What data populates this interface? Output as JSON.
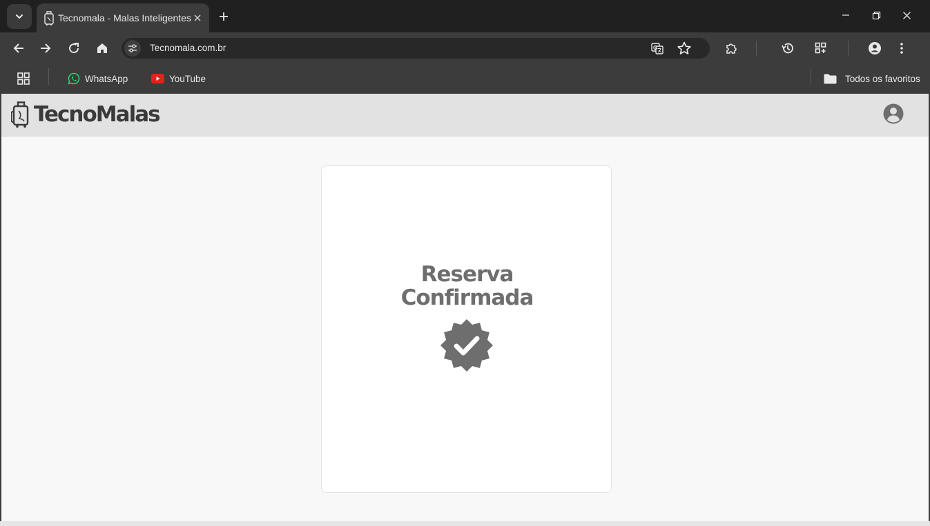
{
  "browser": {
    "tab": {
      "title": "Tecnomala - Malas Inteligentes",
      "favicon": "suitcase-icon"
    },
    "address_bar": {
      "url": "Tecnomala.com.br"
    },
    "bookmarks": [
      {
        "label": "WhatsApp",
        "icon": "whatsapp-icon",
        "color": "#25d366"
      },
      {
        "label": "YouTube",
        "icon": "youtube-icon",
        "color": "#e62117"
      }
    ],
    "all_bookmarks_label": "Todos os favoritos"
  },
  "site": {
    "brand": "TecnoMalas",
    "header_bg": "#e2e2e2",
    "account_icon": "account-circle-icon"
  },
  "confirmation": {
    "title_line1": "Reserva",
    "title_line2": "Confirmada",
    "icon": "verified-badge-icon",
    "accent_color": "#6e6e6e"
  }
}
